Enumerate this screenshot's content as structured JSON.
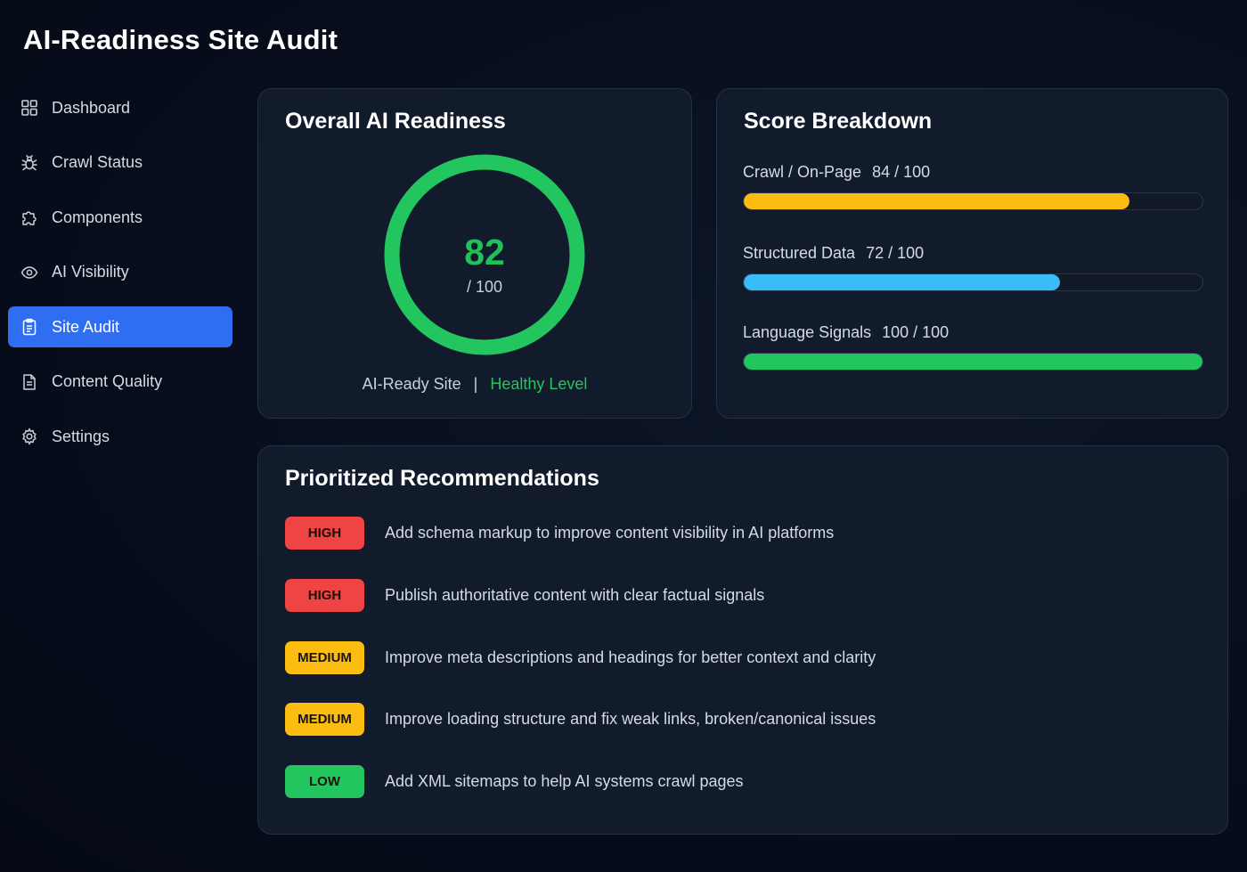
{
  "app": {
    "title": "AI-Readiness Site Audit"
  },
  "sidebar": {
    "items": [
      {
        "label": "Dashboard",
        "icon": "dashboard-grid-icon",
        "active": false
      },
      {
        "label": "Crawl Status",
        "icon": "bug-icon",
        "active": false
      },
      {
        "label": "Components",
        "icon": "puzzle-icon",
        "active": false
      },
      {
        "label": "AI Visibility",
        "icon": "eye-icon",
        "active": false
      },
      {
        "label": "Site Audit",
        "icon": "clipboard-icon",
        "active": true
      },
      {
        "label": "Content Quality",
        "icon": "document-icon",
        "active": false
      },
      {
        "label": "Settings",
        "icon": "gear-icon",
        "active": false
      }
    ]
  },
  "overall": {
    "title": "Overall AI Readiness",
    "score": "82",
    "max": "/ 100",
    "score_fraction": 1.0,
    "status_label": "AI-Ready Site",
    "separator": "|",
    "health_label": "Healthy Level"
  },
  "breakdown": {
    "title": "Score Breakdown",
    "metrics": [
      {
        "label": "Crawl / On-Page",
        "value": "84 / 100",
        "fraction": 0.84,
        "color": "#fbbd12"
      },
      {
        "label": "Structured Data",
        "value": "72 / 100",
        "fraction": 0.69,
        "color": "#38bdf8"
      },
      {
        "label": "Language Signals",
        "value": "100 / 100",
        "fraction": 1.0,
        "color": "#22c55e"
      }
    ]
  },
  "recommendations": {
    "title": "Prioritized Recommendations",
    "items": [
      {
        "priority": "HIGH",
        "color": "#ef4444",
        "text": "Add schema markup to improve content visibility in AI platforms"
      },
      {
        "priority": "HIGH",
        "color": "#ef4444",
        "text": "Publish authoritative content with clear factual signals"
      },
      {
        "priority": "MEDIUM",
        "color": "#fbbd12",
        "text": "Improve meta descriptions and headings for better context and clarity"
      },
      {
        "priority": "MEDIUM",
        "color": "#fbbd12",
        "text": "Improve loading structure and fix weak links, broken/canonical issues"
      },
      {
        "priority": "LOW",
        "color": "#22c55e",
        "text": "Add XML sitemaps to help AI systems crawl pages"
      }
    ]
  },
  "colors": {
    "accent": "#2f6ef2",
    "healthy": "#22c55e",
    "card_bg": "#121b2c"
  }
}
